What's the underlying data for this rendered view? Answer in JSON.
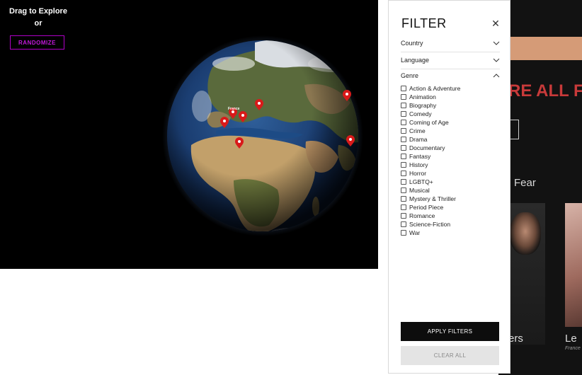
{
  "globe_panel": {
    "drag_title": "Drag to Explore",
    "drag_or": "or",
    "randomize_label": "RANDOMIZE",
    "marker_label": "France"
  },
  "background_page": {
    "heading_fragment": "RE ALL F",
    "subheading_fragment": "Fear",
    "caption_1": "ers",
    "caption_2": "Le",
    "caption_2_sub": "France"
  },
  "filter": {
    "title": "FILTER",
    "close_icon": "close-icon",
    "sections": [
      {
        "label": "Country",
        "expanded": false
      },
      {
        "label": "Language",
        "expanded": false
      },
      {
        "label": "Genre",
        "expanded": true
      }
    ],
    "genres": [
      "Action & Adventure",
      "Animation",
      "Biography",
      "Comedy",
      "Coming of Age",
      "Crime",
      "Drama",
      "Documentary",
      "Fantasy",
      "History",
      "Horror",
      "LGBTQ+",
      "Musical",
      "Mystery & Thriller",
      "Period Piece",
      "Romance",
      "Science-Fiction",
      "War"
    ],
    "apply_label": "APPLY FILTERS",
    "clear_label": "CLEAR ALL"
  },
  "colors": {
    "randomize_accent": "#c21adb",
    "marker_red": "#d91a1a",
    "bg_heading_red": "#c83a3a"
  }
}
